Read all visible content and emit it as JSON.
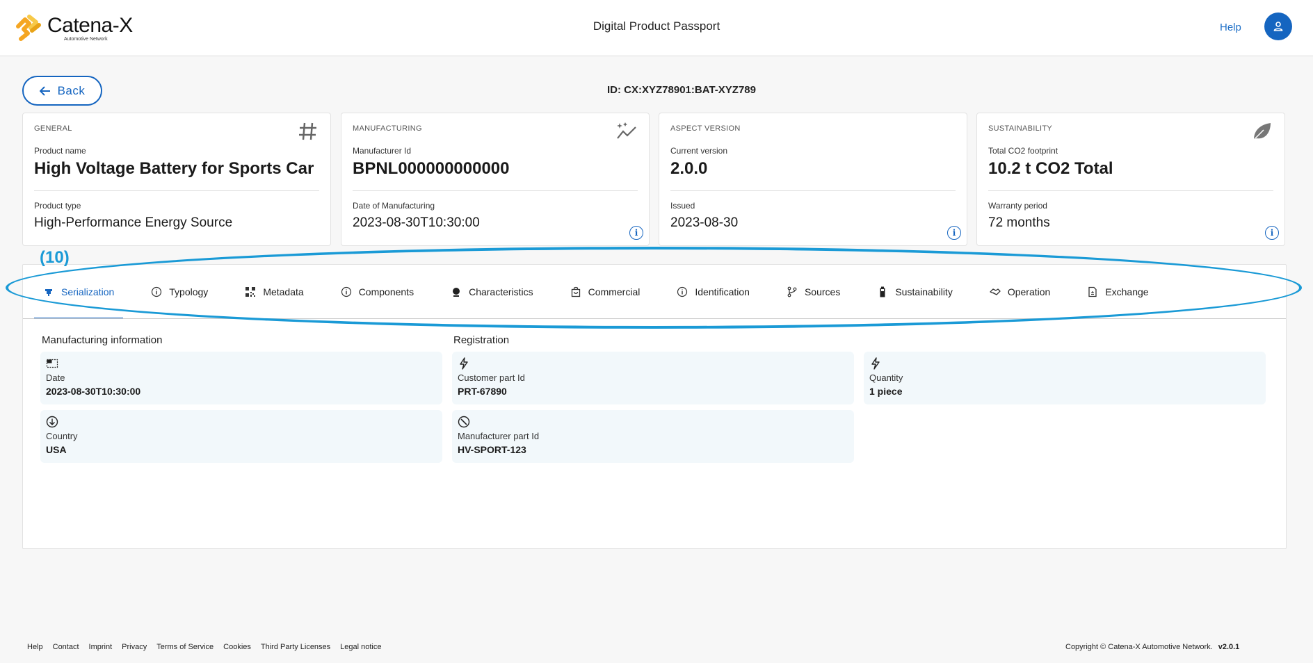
{
  "header": {
    "logo_text": "Catena-X",
    "logo_subtext": "Automotive Network",
    "title": "Digital Product Passport",
    "help_label": "Help",
    "avatar_icon": "user-icon"
  },
  "passport": {
    "back_label": "Back",
    "id_text": "ID: CX:XYZ78901:BAT-XYZ789"
  },
  "cards": [
    {
      "category": "GENERAL",
      "icon": "hash-icon",
      "label1": "Product name",
      "value1": "High Voltage Battery for Sports Car",
      "label2": "Product type",
      "value2": "High-Performance Energy Source"
    },
    {
      "category": "MANUFACTURING",
      "icon": "manufacturing-chart-icon",
      "label1": "Manufacturer Id",
      "value1": "BPNL000000000000",
      "label2": "Date of Manufacturing",
      "value2": "2023-08-30T10:30:00"
    },
    {
      "category": "ASPECT VERSION",
      "icon": "",
      "label1": "Current version",
      "value1": "2.0.0",
      "label2": "Issued",
      "value2": "2023-08-30"
    },
    {
      "category": "SUSTAINABILITY",
      "icon": "leaf-icon",
      "label1": "Total CO2 footprint",
      "value1": "10.2 t CO2 Total",
      "label2": "Warranty period",
      "value2": "72 months"
    }
  ],
  "annotation": {
    "label": "(10)",
    "color": "#1a9ad6"
  },
  "tabs": [
    {
      "label": "Serialization",
      "icon": "serialization-icon",
      "active": true
    },
    {
      "label": "Typology",
      "icon": "info-icon"
    },
    {
      "label": "Metadata",
      "icon": "qr-code-icon"
    },
    {
      "label": "Components",
      "icon": "info-icon"
    },
    {
      "label": "Characteristics",
      "icon": "pin-icon"
    },
    {
      "label": "Commercial",
      "icon": "shopping-bag-icon"
    },
    {
      "label": "Identification",
      "icon": "info-icon"
    },
    {
      "label": "Sources",
      "icon": "branch-icon"
    },
    {
      "label": "Sustainability",
      "icon": "battery-icon"
    },
    {
      "label": "Operation",
      "icon": "handshake-icon"
    },
    {
      "label": "Exchange",
      "icon": "document-icon"
    }
  ],
  "sections": {
    "manufacturing_title": "Manufacturing information",
    "registration_title": "Registration"
  },
  "fields": {
    "date": {
      "label": "Date",
      "value": "2023-08-30T10:30:00",
      "icon": "calendar-dotted-icon"
    },
    "country": {
      "label": "Country",
      "value": "USA",
      "icon": "arrow-down-circle-icon"
    },
    "customer_part": {
      "label": "Customer part Id",
      "value": "PRT-67890",
      "icon": "bolt-icon"
    },
    "manufacturer_part": {
      "label": "Manufacturer part Id",
      "value": "HV-SPORT-123",
      "icon": "compass-icon"
    },
    "quantity": {
      "label": "Quantity",
      "value": "1 piece",
      "icon": "bolt-icon"
    }
  },
  "footer": {
    "links": [
      "Help",
      "Contact",
      "Imprint",
      "Privacy",
      "Terms of Service",
      "Cookies",
      "Third Party Licenses",
      "Legal notice"
    ],
    "copyright": "Copyright © Catena-X Automotive Network.",
    "version": "v2.0.1"
  },
  "colors": {
    "accent": "#1565c0",
    "field_bg": "#f2f8fb",
    "logo_orange": "#f5a623",
    "logo_yellow": "#f7c948"
  }
}
